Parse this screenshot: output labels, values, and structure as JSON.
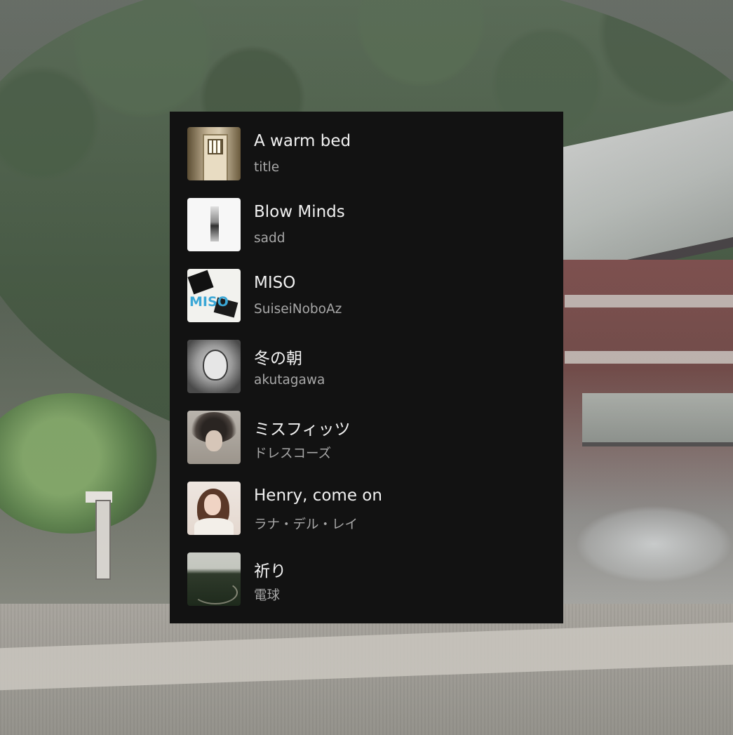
{
  "tracks": [
    {
      "title": "A warm bed",
      "artist": "title",
      "cover_icon": "album-cover-door"
    },
    {
      "title": "Blow Minds",
      "artist": "sadd",
      "cover_icon": "album-cover-white-slab"
    },
    {
      "title": "MISO",
      "artist": "SuiseiNoboAz",
      "cover_icon": "album-cover-miso",
      "cover_text": "MISO"
    },
    {
      "title": "冬の朝",
      "artist": "akutagawa",
      "cover_icon": "album-cover-girl-sketch"
    },
    {
      "title": "ミスフィッツ",
      "artist": "ドレスコーズ",
      "cover_icon": "album-cover-messy-hair"
    },
    {
      "title": "Henry, come on",
      "artist": "ラナ・デル・レイ",
      "cover_icon": "album-cover-portrait"
    },
    {
      "title": "祈り",
      "artist": "電球",
      "cover_icon": "album-cover-landscape"
    }
  ],
  "colors": {
    "panel_background": "#121212",
    "title_text": "#f1f1f1",
    "subtitle_text": "#a8a8a8"
  }
}
